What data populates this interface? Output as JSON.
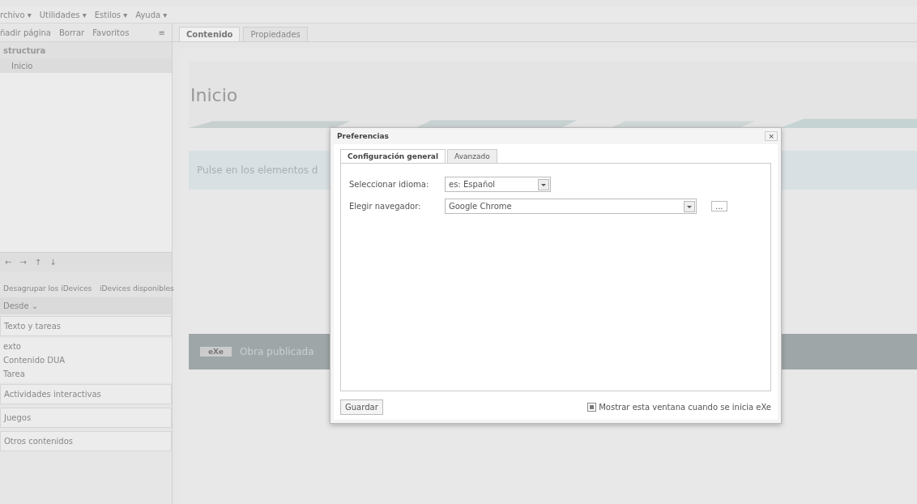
{
  "menubar": [
    "rchivo ▾",
    "Utilidades ▾",
    "Estilos ▾",
    "Ayuda ▾"
  ],
  "toolbar": [
    "ñadir página",
    "Borrar",
    "Favoritos"
  ],
  "collapse_button": "≡",
  "structure": {
    "title": "structura",
    "items": [
      {
        "label": "Inicio",
        "selected": true
      }
    ]
  },
  "nav_buttons": [
    "←",
    "→",
    "↑",
    "↓"
  ],
  "idevices_bar": [
    "Desagrupar los iDevices",
    "iDevices disponibles"
  ],
  "section": "Desde ⌄",
  "groups": [
    {
      "label": "Texto y tareas",
      "children": [
        "exto",
        "Contenido DUA",
        "Tarea"
      ]
    },
    {
      "label": "Actividades interactivas"
    },
    {
      "label": "Juegos"
    },
    {
      "label": "Otros contenidos"
    }
  ],
  "tabs": [
    {
      "label": "Contenido",
      "selected": true
    },
    {
      "label": "Propiedades",
      "selected": false
    }
  ],
  "page_title": "Inicio",
  "banner": "Pulse en los elementos d",
  "footer": {
    "logo": "eXe",
    "text": "Obra publicada"
  },
  "dialog": {
    "title": "Preferencias",
    "close": "×",
    "tabs": [
      {
        "label": "Configuración general",
        "selected": true
      },
      {
        "label": "Avanzado",
        "selected": false
      }
    ],
    "fields": [
      {
        "label": "Seleccionar idioma:",
        "value": "es: Español",
        "wide": false
      },
      {
        "label": "Elegir navegador:",
        "value": "Google Chrome",
        "wide": true,
        "extra": "..."
      }
    ],
    "save": "Guardar",
    "show_on_start": {
      "label": "Mostrar esta ventana cuando se inicia eXe",
      "checked": true
    }
  }
}
